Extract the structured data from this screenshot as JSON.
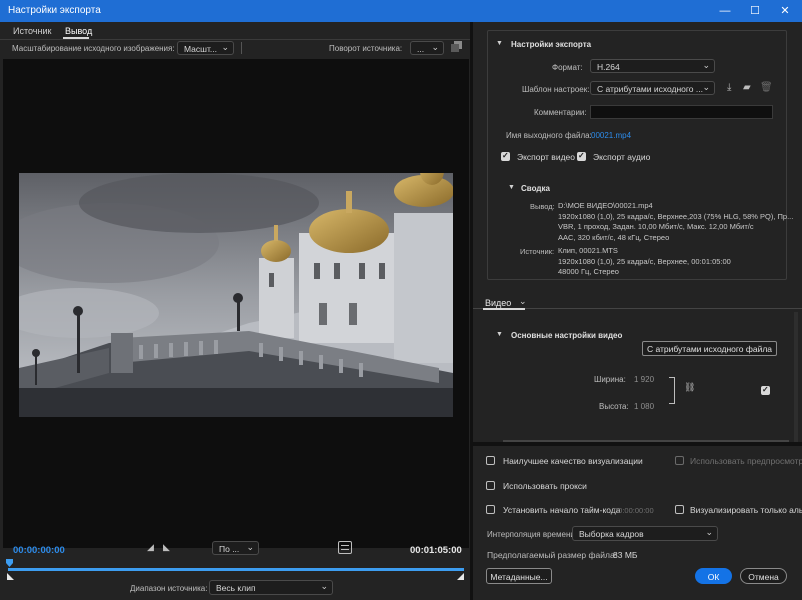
{
  "window": {
    "title": "Настройки экспорта",
    "minimize": "—",
    "maximize": "☐",
    "close": "✕"
  },
  "left": {
    "tabs": [
      {
        "label": "Источник"
      },
      {
        "label": "Вывод"
      }
    ],
    "scaling_label": "Масштабирование исходного изображения:",
    "scaling_value": "Масшт...",
    "rotate_label": "Поворот источника:",
    "rotate_value": "...",
    "timecode_start": "00:00:00:00",
    "timecode_end": "00:01:05:00",
    "fit_value": "По ...",
    "source_range_label": "Диапазон источника:",
    "source_range_value": "Весь клип",
    "playhead_progress": 0.0
  },
  "export_settings": {
    "section_title": "Настройки экспорта",
    "format_label": "Формат:",
    "format_value": "H.264",
    "preset_label": "Шаблон настроек:",
    "preset_value": "С атрибутами исходного ...",
    "comments_label": "Комментарии:",
    "comments_value": "",
    "output_name_label": "Имя выходного файла:",
    "output_name_value": "00021.mp4",
    "export_video_label": "Экспорт видео",
    "export_audio_label": "Экспорт аудио",
    "export_video_checked": true,
    "export_audio_checked": true,
    "summary_title": "Сводка",
    "output_label": "Вывод:",
    "output_lines": [
      "D:\\МОЕ ВИДЕО\\00021.mp4",
      "1920x1080 (1,0), 25 кадра/с, Верхнее,203 (75% HLG, 58% PQ), Пр...",
      "VBR, 1 проход, Задан. 10,00 Мбит/с, Макс. 12,00 Мбит/с",
      "AAC, 320 кбит/с, 48 кГц, Стерео"
    ],
    "source_label": "Источник:",
    "source_lines": [
      "Клип, 00021.MTS",
      "1920x1080 (1,0), 25 кадра/с, Верхнее, 00:01:05:00",
      "48000 Гц, Стерео"
    ]
  },
  "video": {
    "tab_label": "Видео",
    "basic_title": "Основные настройки видео",
    "match_source_button": "С атрибутами исходного файла",
    "width_label": "Ширина:",
    "width_value": "1 920",
    "height_label": "Высота:",
    "height_value": "1 080",
    "linked_checked": true
  },
  "bottom": {
    "max_quality_label": "Наилучшее качество визуализации",
    "use_previews_label": "Использовать предпросмотр",
    "use_proxy_label": "Использовать прокси",
    "set_timecode_label": "Установить начало тайм-кода",
    "timecode_value": "00:00:00:00",
    "render_alpha_label": "Визуализировать только альф",
    "interp_label": "Интерполяция времени:",
    "interp_value": "Выборка кадров",
    "est_size_label": "Предполагаемый размер файла:",
    "est_size_value": "83 МБ",
    "metadata_button": "Метаданные...",
    "ok_button": "ОК",
    "cancel_button": "Отмена"
  },
  "colors": {
    "accent": "#1473e6",
    "titlebar": "#1f6ed4",
    "timecode": "#2d8ceb",
    "background": "#232323"
  }
}
